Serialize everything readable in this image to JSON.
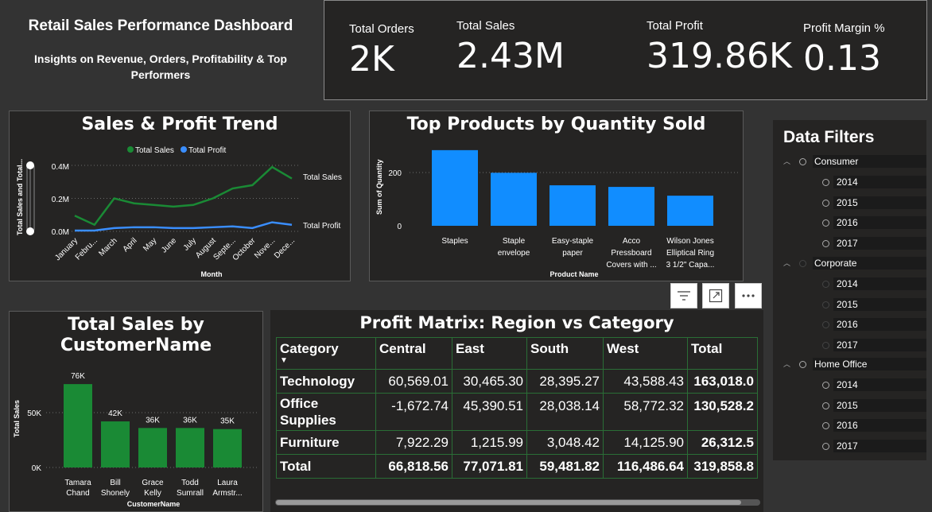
{
  "header": {
    "title": "Retail Sales Performance Dashboard",
    "subtitle": "Insights on Revenue, Orders, Profitability & Top Performers"
  },
  "kpis": [
    {
      "label": "Total Orders",
      "value": "2K"
    },
    {
      "label": "Total Sales",
      "value": "2.43M"
    },
    {
      "label": "Total Profit",
      "value": "319.86K"
    },
    {
      "label": "Profit Margin %",
      "value": "0.13"
    }
  ],
  "trend_chart": {
    "title": "Sales & Profit Trend",
    "legend": [
      "Total Sales",
      "Total Profit"
    ],
    "ylabel": "Total Sales and Total...",
    "xlabel": "Month",
    "yticks": [
      "0.4M",
      "0.2M",
      "0.0M"
    ],
    "end_labels": [
      "Total Sales",
      "Total Profit"
    ]
  },
  "products_chart": {
    "title": "Top Products by Quantity Sold",
    "ylabel": "Sum of Quantity",
    "xlabel": "Product Name",
    "yticks": [
      "200",
      "0"
    ],
    "category_lines": [
      [
        "Staples"
      ],
      [
        "Staple",
        "envelope"
      ],
      [
        "Easy-staple",
        "paper"
      ],
      [
        "Acco",
        "Pressboard",
        "Covers with ..."
      ],
      [
        "Wilson Jones",
        "Elliptical Ring",
        "3 1/2\" Capa..."
      ]
    ]
  },
  "customer_chart": {
    "title_lines": [
      "Total Sales by",
      "CustomerName"
    ],
    "ylabel": "Total Sales",
    "xlabel": "CustomerName",
    "yticks": [
      "50K",
      "0K"
    ],
    "category_lines": [
      [
        "Tamara",
        "Chand"
      ],
      [
        "Bill",
        "Shonely"
      ],
      [
        "Grace",
        "Kelly"
      ],
      [
        "Todd",
        "Sumrall"
      ],
      [
        "Laura",
        "Armstr..."
      ]
    ],
    "data_labels": [
      "76K",
      "42K",
      "36K",
      "36K",
      "35K"
    ]
  },
  "chart_data": [
    {
      "type": "line",
      "title": "Sales & Profit Trend",
      "xlabel": "Month",
      "ylabel": "Total Sales and Total...",
      "x": [
        "January",
        "Febru...",
        "March",
        "April",
        "May",
        "June",
        "July",
        "August",
        "Septe...",
        "October",
        "Nove...",
        "Dece..."
      ],
      "series": [
        {
          "name": "Total Sales",
          "color": "#1a8a35",
          "values": [
            0.095,
            0.04,
            0.2,
            0.17,
            0.16,
            0.15,
            0.16,
            0.2,
            0.26,
            0.28,
            0.39,
            0.32
          ]
        },
        {
          "name": "Total Profit",
          "color": "#3a8eff",
          "values": [
            0.005,
            0.005,
            0.02,
            0.025,
            0.025,
            0.02,
            0.02,
            0.025,
            0.03,
            0.02,
            0.055,
            0.04
          ]
        }
      ],
      "ylim": [
        0,
        0.45
      ],
      "units": "M"
    },
    {
      "type": "bar",
      "title": "Top Products by Quantity Sold",
      "xlabel": "Product Name",
      "ylabel": "Sum of Quantity",
      "categories": [
        "Staples",
        "Staple envelope",
        "Easy-staple paper",
        "Acco Pressboard Covers with ...",
        "Wilson Jones Elliptical Ring 3 1/2\" Capa..."
      ],
      "values": [
        284,
        199,
        152,
        146,
        113
      ],
      "ylim": [
        0,
        300
      ],
      "color": "#118dff"
    },
    {
      "type": "bar",
      "title": "Total Sales by CustomerName",
      "xlabel": "CustomerName",
      "ylabel": "Total Sales",
      "categories": [
        "Tamara Chand",
        "Bill Shonely",
        "Grace Kelly",
        "Todd Sumrall",
        "Laura Armstr..."
      ],
      "values": [
        76,
        42,
        36,
        36,
        35
      ],
      "units": "K",
      "ylim": [
        0,
        80
      ],
      "color": "#1a8a35"
    },
    {
      "type": "table",
      "title": "Profit Matrix: Region vs Category",
      "columns": [
        "Category",
        "Central",
        "East",
        "South",
        "West",
        "Total"
      ],
      "rows": [
        [
          "Technology",
          "60,569.01",
          "30,465.30",
          "28,395.27",
          "43,588.43",
          "163,018.0"
        ],
        [
          "Office Supplies",
          "-1,672.74",
          "45,390.51",
          "28,038.14",
          "58,772.32",
          "130,528.2"
        ],
        [
          "Furniture",
          "7,922.29",
          "1,215.99",
          "3,048.42",
          "14,125.90",
          "26,312.5"
        ],
        [
          "Total",
          "66,818.56",
          "77,071.81",
          "59,481.82",
          "116,486.64",
          "319,858.8"
        ]
      ]
    }
  ],
  "filters": {
    "title": "Data Filters",
    "segments": [
      {
        "label": "Consumer",
        "years": [
          "2014",
          "2015",
          "2016",
          "2017"
        ]
      },
      {
        "label": "Corporate",
        "years": [
          "2014",
          "2015",
          "2016",
          "2017"
        ]
      },
      {
        "label": "Home Office",
        "years": [
          "2014",
          "2015",
          "2016",
          "2017"
        ]
      }
    ]
  },
  "toolbar": {
    "icons": [
      "filter-icon",
      "focus-mode-icon",
      "more-options-icon"
    ]
  }
}
